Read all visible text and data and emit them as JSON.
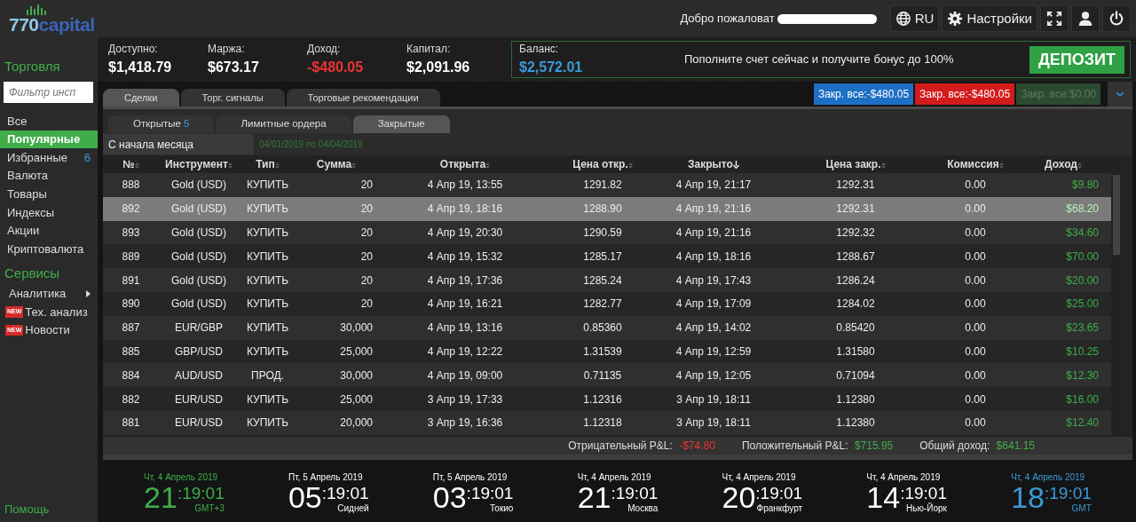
{
  "logo": {
    "lead": "770",
    "rest": "capital"
  },
  "header": {
    "welcome": "Добро пожаловат",
    "language": "RU",
    "settings": "Настройки"
  },
  "account": [
    {
      "label": "Доступно:",
      "value": "$1,418.79",
      "negative": false
    },
    {
      "label": "Маржа:",
      "value": "$673.17",
      "negative": false
    },
    {
      "label": "Доход:",
      "value": "-$480.05",
      "negative": true
    },
    {
      "label": "Капитал:",
      "value": "$2,091.96",
      "negative": false
    }
  ],
  "balance": {
    "label": "Баланс:",
    "value": "$2,572.01",
    "promo": "Пополните счет сейчас и получите бонус до 100%",
    "deposit": "ДЕПОЗИТ"
  },
  "sidebar": {
    "title": "Торговля",
    "filter_placeholder": "Фильтр инсп",
    "items": [
      {
        "label": "Все",
        "selected": false
      },
      {
        "label": "Популярные",
        "selected": true
      },
      {
        "label": "Избранные",
        "selected": false,
        "count": "6"
      },
      {
        "label": "Валюта",
        "selected": false
      },
      {
        "label": "Товары",
        "selected": false
      },
      {
        "label": "Индексы",
        "selected": false
      },
      {
        "label": "Акции",
        "selected": false
      },
      {
        "label": "Криптовалюта",
        "selected": false
      }
    ],
    "services_title": "Сервисы",
    "services": [
      {
        "label": "Аналитика",
        "kind": "submenu"
      },
      {
        "label": "Тех. анализ",
        "kind": "new",
        "badge": "NEW"
      },
      {
        "label": "Новости",
        "kind": "new",
        "badge": "NEW"
      }
    ],
    "help": "Помощь"
  },
  "tabs": [
    {
      "label": "Сделки",
      "selected": true
    },
    {
      "label": "Торг. сигналы",
      "selected": false
    },
    {
      "label": "Торговые рекомендации",
      "selected": false
    }
  ],
  "close_buttons": [
    {
      "label": "Закр. все:-$480.05",
      "kind": "primary"
    },
    {
      "label": "Закр. все:-$480.05",
      "kind": "danger"
    },
    {
      "label": "Закр. все:$0.00",
      "kind": "disabled"
    }
  ],
  "subtabs": [
    {
      "label": "Открытые",
      "count": "5",
      "selected": false
    },
    {
      "label": "Лимитные ордера",
      "selected": false
    },
    {
      "label": "Закрытые",
      "selected": true
    }
  ],
  "period": {
    "value": "С начала месяца",
    "range": "04/01/2019 по 04/04/2019"
  },
  "table": {
    "columns": [
      {
        "label": "№",
        "sorted": false
      },
      {
        "label": "Инструмент",
        "sorted": false
      },
      {
        "label": "Тип",
        "sorted": false
      },
      {
        "label": "Сумма",
        "sorted": false
      },
      {
        "label": "Открыта",
        "sorted": false
      },
      {
        "label": "Цена откр.",
        "sorted": false
      },
      {
        "label": "Закрыто",
        "sorted": true
      },
      {
        "label": "Цена закр.",
        "sorted": false
      },
      {
        "label": "Комиссия",
        "sorted": false
      },
      {
        "label": "Доход",
        "sorted": false
      }
    ],
    "rows": [
      {
        "selected": false,
        "cells": [
          "888",
          "Gold (USD)",
          "КУПИТЬ",
          "20",
          "4 Апр 19, 13:55",
          "1291.82",
          "4 Апр 19, 21:17",
          "1292.31",
          "0.00",
          "$9.80"
        ]
      },
      {
        "selected": true,
        "cells": [
          "892",
          "Gold (USD)",
          "КУПИТЬ",
          "20",
          "4 Апр 19, 18:16",
          "1288.90",
          "4 Апр 19, 21:16",
          "1292.31",
          "0.00",
          "$68.20"
        ]
      },
      {
        "selected": false,
        "cells": [
          "893",
          "Gold (USD)",
          "КУПИТЬ",
          "20",
          "4 Апр 19, 20:30",
          "1290.59",
          "4 Апр 19, 21:16",
          "1292.32",
          "0.00",
          "$34.60"
        ]
      },
      {
        "selected": false,
        "cells": [
          "889",
          "Gold (USD)",
          "КУПИТЬ",
          "20",
          "4 Апр 19, 15:32",
          "1285.17",
          "4 Апр 19, 18:16",
          "1288.67",
          "0.00",
          "$70.00"
        ]
      },
      {
        "selected": false,
        "cells": [
          "891",
          "Gold (USD)",
          "КУПИТЬ",
          "20",
          "4 Апр 19, 17:36",
          "1285.24",
          "4 Апр 19, 17:43",
          "1286.24",
          "0.00",
          "$20.00"
        ]
      },
      {
        "selected": false,
        "cells": [
          "890",
          "Gold (USD)",
          "КУПИТЬ",
          "20",
          "4 Апр 19, 16:21",
          "1282.77",
          "4 Апр 19, 17:09",
          "1284.02",
          "0.00",
          "$25.00"
        ]
      },
      {
        "selected": false,
        "cells": [
          "887",
          "EUR/GBP",
          "КУПИТЬ",
          "30,000",
          "4 Апр 19, 13:16",
          "0.85360",
          "4 Апр 19, 14:02",
          "0.85420",
          "0.00",
          "$23.65"
        ]
      },
      {
        "selected": false,
        "cells": [
          "885",
          "GBP/USD",
          "КУПИТЬ",
          "25,000",
          "4 Апр 19, 12:22",
          "1.31539",
          "4 Апр 19, 12:59",
          "1.31580",
          "0.00",
          "$10.25"
        ]
      },
      {
        "selected": false,
        "cells": [
          "884",
          "AUD/USD",
          "ПРОД.",
          "30,000",
          "4 Апр 19, 09:00",
          "0.71135",
          "4 Апр 19, 12:05",
          "0.71094",
          "0.00",
          "$12.30"
        ]
      },
      {
        "selected": false,
        "cells": [
          "882",
          "EUR/USD",
          "КУПИТЬ",
          "25,000",
          "3 Апр 19, 17:33",
          "1.12316",
          "3 Апр 19, 18:11",
          "1.12380",
          "0.00",
          "$16.00"
        ]
      },
      {
        "selected": false,
        "cells": [
          "881",
          "EUR/USD",
          "КУПИТЬ",
          "20,000",
          "3 Апр 19, 16:36",
          "1.12318",
          "3 Апр 19, 18:11",
          "1.12380",
          "0.00",
          "$12.40"
        ]
      }
    ]
  },
  "summary": [
    {
      "label": "Отрицательный P&L:",
      "value": "-$74.80",
      "negative": true
    },
    {
      "label": "Положительный P&L:",
      "value": "$715.95",
      "negative": false
    },
    {
      "label": "Общий доход:",
      "value": "$641.15",
      "negative": false
    }
  ],
  "clocks": [
    {
      "date": "Чт, 4 Апрель 2019",
      "hour": "21",
      "time": ":19:01",
      "place": "GMT+3",
      "color": "#3fae49"
    },
    {
      "date": "Пт, 5 Апрель 2019",
      "hour": "05",
      "time": ":19:01",
      "place": "Сидней",
      "color": "#ffffff"
    },
    {
      "date": "Пт, 5 Апрель 2019",
      "hour": "03",
      "time": ":19:01",
      "place": "Токио",
      "color": "#ffffff"
    },
    {
      "date": "Чт, 4 Апрель 2019",
      "hour": "21",
      "time": ":19:01",
      "place": "Москва",
      "color": "#ffffff"
    },
    {
      "date": "Чт, 4 Апрель 2019",
      "hour": "20",
      "time": ":19:01",
      "place": "Франкфурт",
      "color": "#ffffff"
    },
    {
      "date": "Чт, 4 Апрель 2019",
      "hour": "14",
      "time": ":19:01",
      "place": "Нью-Йорк",
      "color": "#ffffff"
    },
    {
      "date": "Чт, 4 Апрель 2019",
      "hour": "18",
      "time": ":19:01",
      "place": "GMT",
      "color": "#3a9ad9"
    }
  ]
}
